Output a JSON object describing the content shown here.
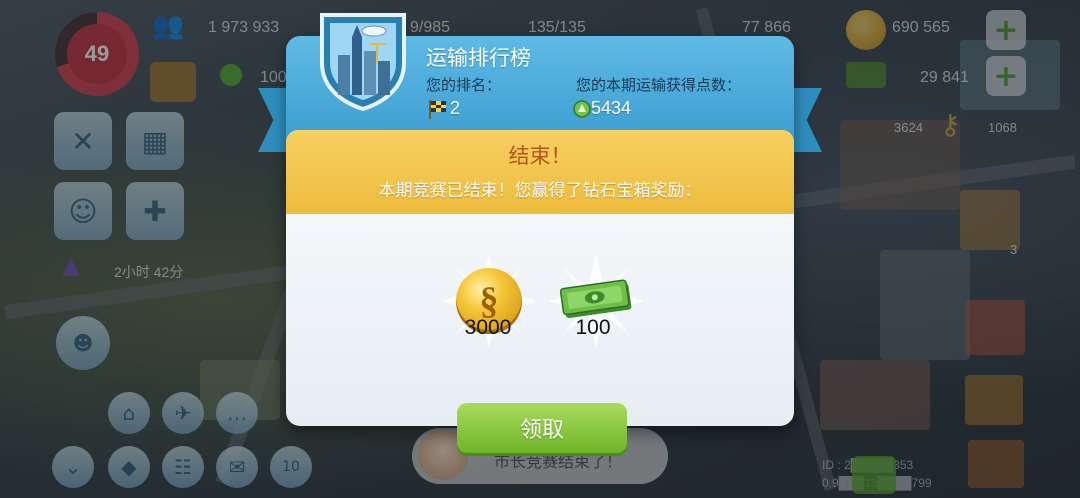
{
  "hud": {
    "level": "49",
    "population": "1 973 933",
    "stat2": "9/985",
    "stat3": "135/135",
    "stat4": "77 866",
    "simoleons": "690 565",
    "simcash": "29 841",
    "happiness": "100",
    "timer": "2小时 42分",
    "count_a": "3624",
    "count_b": "1068",
    "count_c": "3",
    "building_level": "10",
    "chat_preview": "市长竞赛结束了！",
    "id_line1": "ID : 2█████353",
    "id_line2": "0.9███13████799"
  },
  "dialog": {
    "title": "运输排行榜",
    "rank_label": "您的排名：",
    "rank_value": "2",
    "points_label": "您的本期运输获得点数：",
    "points_value": "5434",
    "banner_title": "结束！",
    "banner_subtitle": "本期竞赛已结束！您赢得了钻石宝箱奖励：",
    "rewards": [
      {
        "icon": "simoleon-coin-icon",
        "amount": "3000"
      },
      {
        "icon": "simcash-bill-icon",
        "amount": "100"
      }
    ],
    "claim_label": "领取"
  },
  "colors": {
    "header_blue": "#3b9dd0",
    "banner_yellow": "#eebc3d",
    "claim_green": "#6fb42a"
  }
}
